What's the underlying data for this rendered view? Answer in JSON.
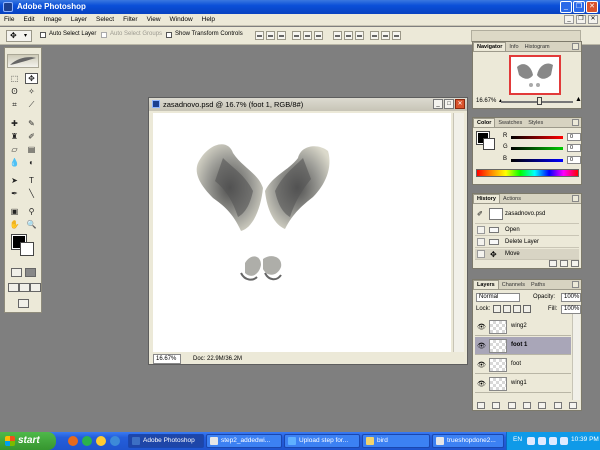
{
  "window": {
    "title": "Adobe Photoshop"
  },
  "menu": [
    "File",
    "Edit",
    "Image",
    "Layer",
    "Select",
    "Filter",
    "View",
    "Window",
    "Help"
  ],
  "options": {
    "auto_select_layer": "Auto Select Layer",
    "auto_select_groups": "Auto Select Groups",
    "show_transform_controls": "Show Transform Controls"
  },
  "document": {
    "title": "zasadnovo.psd @ 16.7% (foot 1, RGB/8#)",
    "zoom": "16.67%",
    "doc_size": "Doc: 22.9M/36.2M"
  },
  "navigator": {
    "tabs": [
      "Navigator",
      "Info",
      "Histogram"
    ],
    "zoom": "16.67%"
  },
  "color": {
    "tabs": [
      "Color",
      "Swatches",
      "Styles"
    ],
    "channels": [
      {
        "label": "R",
        "value": "0"
      },
      {
        "label": "G",
        "value": "0"
      },
      {
        "label": "B",
        "value": "0"
      }
    ]
  },
  "history": {
    "tabs": [
      "History",
      "Actions"
    ],
    "snapshot": "zasadnovo.psd",
    "items": [
      "Open",
      "Delete Layer",
      "Move"
    ]
  },
  "layers": {
    "tabs": [
      "Layers",
      "Channels",
      "Paths"
    ],
    "blend_mode": "Normal",
    "opacity_label": "Opacity:",
    "opacity": "100%",
    "lock_label": "Lock:",
    "fill_label": "Fill:",
    "fill": "100%",
    "items": [
      {
        "name": "wing2",
        "selected": false
      },
      {
        "name": "foot 1",
        "selected": true
      },
      {
        "name": "foot",
        "selected": false
      },
      {
        "name": "wing1",
        "selected": false
      }
    ]
  },
  "taskbar": {
    "start": "start",
    "tasks": [
      "Adobe Photoshop",
      "step2_addedwi...",
      "Upload step for...",
      "bird",
      "trueshopdone2..."
    ],
    "lang": "EN",
    "clock": "10:39 PM"
  },
  "icons": {
    "move_tool": "move-icon",
    "eye": "eye-icon",
    "start_flag": "windows-flag-icon"
  }
}
